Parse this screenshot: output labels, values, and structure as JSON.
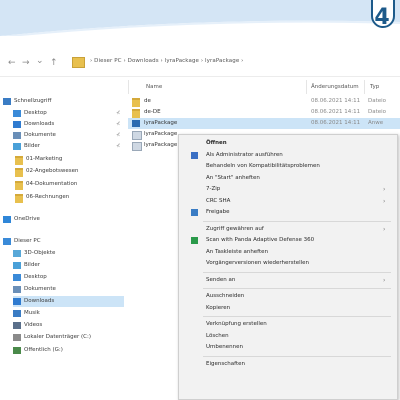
{
  "step_badge": "4",
  "colors": {
    "accent_blue": "#1d5a8a",
    "band_light": "#d4e5f5",
    "selection": "#cce4f7",
    "folder_yellow": "#e8c04e"
  },
  "address": {
    "back_glyph": "←",
    "forward_glyph": "→",
    "dropdown_glyph": "⌄",
    "up_glyph": "↑",
    "path": "›  Dieser PC  ›  Downloads  ›  lyraPackage  ›  lyraPackage  ›"
  },
  "sidebar": {
    "items": [
      {
        "label": "Schnellzugriff",
        "icon": "star-icon",
        "pinned": false
      },
      {
        "label": "Desktop",
        "icon": "desktop-icon",
        "pinned": true
      },
      {
        "label": "Downloads",
        "icon": "download-icon",
        "pinned": true
      },
      {
        "label": "Dokumente",
        "icon": "documents-icon",
        "pinned": true
      },
      {
        "label": "Bilder",
        "icon": "pictures-icon",
        "pinned": true
      },
      {
        "label": "01-Marketing",
        "icon": "folder-icon",
        "pinned": false
      },
      {
        "label": "02-Angebotswesen",
        "icon": "folder-icon",
        "pinned": false
      },
      {
        "label": "04-Dokumentation",
        "icon": "folder-icon",
        "pinned": false
      },
      {
        "label": "06-Rechnungen",
        "icon": "folder-icon",
        "pinned": false
      },
      {
        "label": "OneDrive",
        "icon": "cloud-icon",
        "pinned": false
      },
      {
        "label": "Dieser PC",
        "icon": "pc-icon",
        "pinned": false
      },
      {
        "label": "3D-Objekte",
        "icon": "cube-icon",
        "pinned": false
      },
      {
        "label": "Bilder",
        "icon": "pictures-icon",
        "pinned": false
      },
      {
        "label": "Desktop",
        "icon": "desktop-icon",
        "pinned": false
      },
      {
        "label": "Dokumente",
        "icon": "documents-icon",
        "pinned": false
      },
      {
        "label": "Downloads",
        "icon": "download-icon",
        "pinned": false,
        "selected": true
      },
      {
        "label": "Musik",
        "icon": "music-icon",
        "pinned": false
      },
      {
        "label": "Videos",
        "icon": "video-icon",
        "pinned": false
      },
      {
        "label": "Lokaler Datenträger (C:)",
        "icon": "drive-icon",
        "pinned": false
      },
      {
        "label": "Offentlich (G:)",
        "icon": "network-drive-icon",
        "pinned": false
      }
    ],
    "pin_glyph": "⊀"
  },
  "columns": {
    "name": "Name",
    "date": "Änderungsdatum",
    "type": "Typ"
  },
  "files": [
    {
      "name": "de",
      "icon": "folder-icon",
      "date": "08.06.2021 14:11",
      "type": "Dateio"
    },
    {
      "name": "de-DE",
      "icon": "folder-icon",
      "date": "08.06.2021 14:11",
      "type": "Dateio"
    },
    {
      "name": "lyraPackage",
      "icon": "app-icon",
      "date": "08.06.2021 14:11",
      "type": "Anwe",
      "selected": true
    },
    {
      "name": "lyraPackage",
      "icon": "file-icon",
      "date": "",
      "type": ""
    },
    {
      "name": "lyraPackage",
      "icon": "file-icon",
      "date": "",
      "type": ""
    }
  ],
  "context_menu": {
    "items": [
      {
        "label": "Öffnen",
        "bold": true,
        "icon": ""
      },
      {
        "label": "Als Administrator ausführen",
        "icon": "shield-icon"
      },
      {
        "label": "Behandeln von Kompatibilitätsproblemen",
        "icon": ""
      },
      {
        "label": "An \"Start\" anheften",
        "icon": ""
      },
      {
        "label": "7-Zip",
        "icon": "",
        "submenu": true
      },
      {
        "label": "CRC SHA",
        "icon": "",
        "submenu": true
      },
      {
        "label": "Freigabe",
        "icon": "share-icon"
      },
      {
        "sep": true
      },
      {
        "label": "Zugriff gewähren auf",
        "icon": "",
        "submenu": true
      },
      {
        "label": "Scan with Panda Adaptive Defense 360",
        "icon": "panda-icon"
      },
      {
        "label": "An Taskleiste anheften",
        "icon": ""
      },
      {
        "label": "Vorgängerversionen wiederherstellen",
        "icon": ""
      },
      {
        "sep": true
      },
      {
        "label": "Senden an",
        "icon": "",
        "submenu": true
      },
      {
        "sep": true
      },
      {
        "label": "Ausschneiden",
        "icon": ""
      },
      {
        "label": "Kopieren",
        "icon": ""
      },
      {
        "sep": true
      },
      {
        "label": "Verknüpfung erstellen",
        "icon": ""
      },
      {
        "label": "Löschen",
        "icon": ""
      },
      {
        "label": "Umbenennen",
        "icon": ""
      },
      {
        "sep": true
      },
      {
        "label": "Eigenschaften",
        "icon": ""
      }
    ],
    "arrow_glyph": "›"
  }
}
